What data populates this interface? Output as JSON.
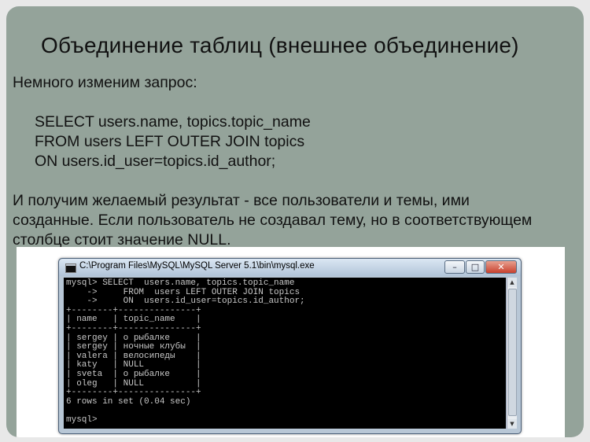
{
  "slide": {
    "title": "Объединение таблиц (внешнее объединение)",
    "intro": "Немного изменим запрос:",
    "query_lines": [
      "SELECT  users.name, topics.topic_name",
      "FROM  users LEFT OUTER JOIN topics",
      "ON  users.id_user=topics.id_author;"
    ],
    "result_lines": [
      "И получим желаемый результат - все пользователи и темы, ими",
      "созданные. Если пользователь не создавал тему, но в соответствующем",
      "столбце стоит значение NULL."
    ]
  },
  "window": {
    "title": "C:\\Program Files\\MySQL\\MySQL Server 5.1\\bin\\mysql.exe",
    "buttons": {
      "minimize": "–",
      "maximize": "□",
      "close": "✕"
    },
    "icons": {
      "app": "console-icon",
      "scroll_up": "▲",
      "scroll_down": "▼"
    }
  },
  "console": {
    "lines": [
      "mysql> SELECT  users.name, topics.topic_name",
      "    ->     FROM  users LEFT OUTER JOIN topics",
      "    ->     ON  users.id_user=topics.id_author;",
      "+--------+---------------+",
      "| name   | topic_name    |",
      "+--------+---------------+",
      "| sergey | о рыбалке     |",
      "| sergey | ночные клубы  |",
      "| valera | велосипеды    |",
      "| katy   | NULL          |",
      "| sveta  | о рыбалке     |",
      "| oleg   | NULL          |",
      "+--------+---------------+",
      "6 rows in set (0.04 sec)",
      "",
      "mysql>"
    ]
  }
}
